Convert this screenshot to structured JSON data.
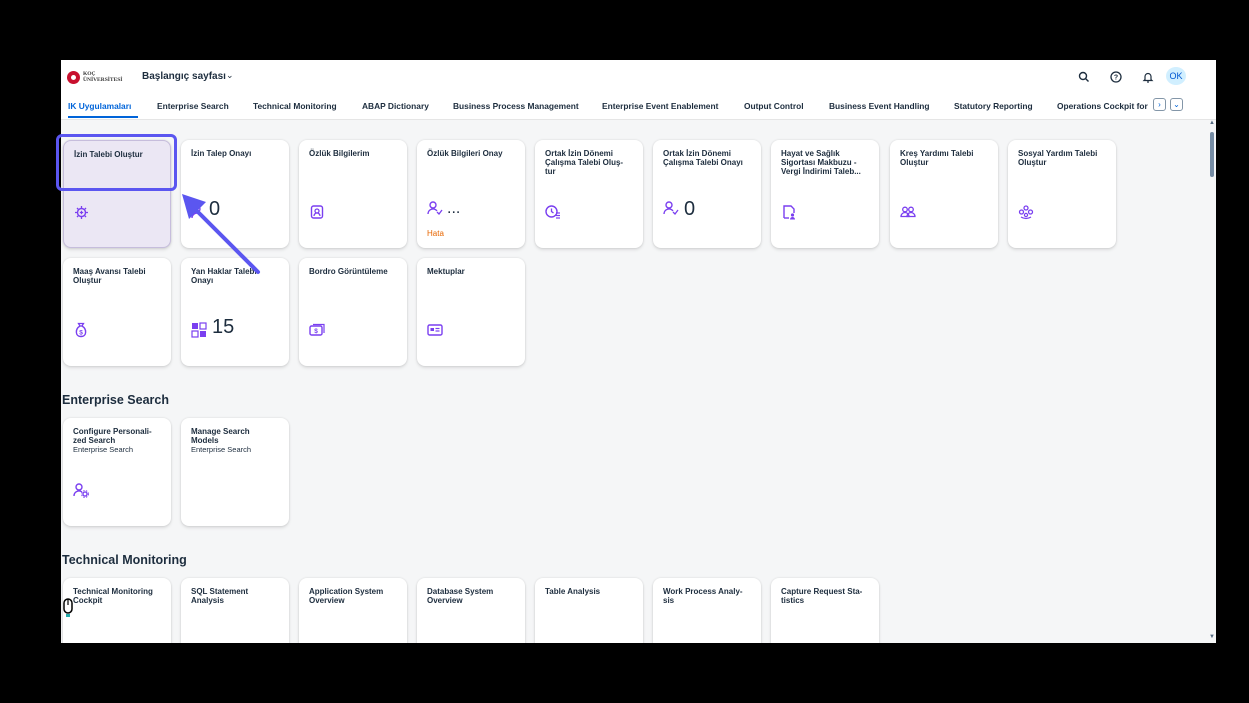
{
  "shell": {
    "logo_line1": "KOÇ",
    "logo_line2": "ÜNİVERSİTESİ",
    "home_title": "Başlangıç sayfası",
    "avatar_initials": "OK"
  },
  "tabs": [
    {
      "label": "IK Uygulamaları",
      "active": true
    },
    {
      "label": "Enterprise Search"
    },
    {
      "label": "Technical Monitoring"
    },
    {
      "label": "ABAP Dictionary"
    },
    {
      "label": "Business Process Management"
    },
    {
      "label": "Enterprise Event Enablement"
    },
    {
      "label": "Output Control"
    },
    {
      "label": "Business Event Handling"
    },
    {
      "label": "Statutory Reporting"
    },
    {
      "label": "Operations Cockpit for"
    }
  ],
  "ik_tiles": [
    {
      "title": "İzin Talebi Oluştur",
      "icon": "create-leave-icon"
    },
    {
      "title": "İzin Talep Onayı",
      "count": "0",
      "icon": "approval-icon"
    },
    {
      "title": "Özlük Bilgilerim",
      "icon": "personal-file-icon"
    },
    {
      "title": "Özlük Bilgileri Onay",
      "count": "...",
      "status": "Hata",
      "icon": "user-approve-icon"
    },
    {
      "title": "Ortak İzin Dönemi Çalışma Talebi Oluş-tur",
      "icon": "time-request-icon"
    },
    {
      "title": "Ortak İzin Dönemi Çalışma Talebi Onayı",
      "count": "0",
      "icon": "user-approve-icon"
    },
    {
      "title": "Hayat ve Sağlık Sigortası Makbuzu - Vergi İndirimi Taleb...",
      "icon": "insurance-doc-icon"
    },
    {
      "title": "Kreş Yardımı Talebi Oluştur",
      "icon": "group-icon"
    },
    {
      "title": "Sosyal Yardım Talebi Oluştur",
      "icon": "social-help-icon"
    },
    {
      "title": "Maaş Avansı Talebi Oluştur",
      "icon": "money-bag-icon"
    },
    {
      "title": "Yan Haklar Talebi Onayı",
      "count": "15",
      "icon": "benefits-grid-icon"
    },
    {
      "title": "Bordro Görüntüleme",
      "icon": "payroll-icon"
    },
    {
      "title": "Mektuplar",
      "icon": "letter-card-icon"
    }
  ],
  "enterprise_search": {
    "heading": "Enterprise Search",
    "tiles": [
      {
        "title": "Configure Personali-zed Search",
        "subtitle": "Enterprise Search",
        "icon": "user-settings-icon"
      },
      {
        "title": "Manage Search Models",
        "subtitle": "Enterprise Search"
      }
    ]
  },
  "technical_monitoring": {
    "heading": "Technical Monitoring",
    "tiles": [
      {
        "title": "Technical Monitoring Cockpit"
      },
      {
        "title": "SQL Statement Analysis"
      },
      {
        "title": "Application System Overview"
      },
      {
        "title": "Database System Overview"
      },
      {
        "title": "Table Analysis"
      },
      {
        "title": "Work Process Analy-sis"
      },
      {
        "title": "Capture Request Sta-tistics"
      }
    ]
  },
  "colors": {
    "accent": "#0064d9",
    "icon_purple": "#7a3ff0",
    "annotation": "#5b56f0",
    "error": "#e76500"
  }
}
